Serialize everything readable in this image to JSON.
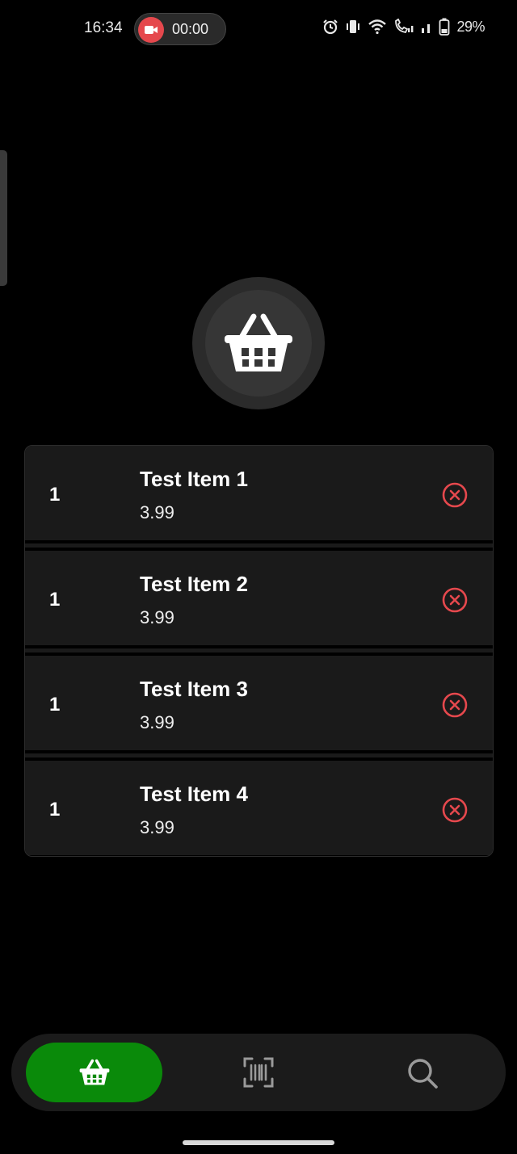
{
  "status_bar": {
    "time": "16:34",
    "recording_time": "00:00",
    "battery_percent": "29%",
    "icons": [
      "alarm-icon",
      "vibrate-icon",
      "wifi-icon",
      "wifi-calling-icon",
      "signal-icon",
      "battery-icon"
    ]
  },
  "header": {
    "icon": "basket-icon"
  },
  "cart": {
    "items": [
      {
        "quantity": "1",
        "name": "Test Item 1",
        "price": "3.99"
      },
      {
        "quantity": "1",
        "name": "Test Item 2",
        "price": "3.99"
      },
      {
        "quantity": "1",
        "name": "Test Item 3",
        "price": "3.99"
      },
      {
        "quantity": "1",
        "name": "Test Item 4",
        "price": "3.99"
      }
    ]
  },
  "bottom_nav": {
    "items": [
      {
        "icon": "basket-icon",
        "active": true
      },
      {
        "icon": "barcode-scan-icon",
        "active": false
      },
      {
        "icon": "search-icon",
        "active": false
      }
    ]
  },
  "colors": {
    "background": "#000000",
    "card": "#1a1a1a",
    "remove": "#e5484d",
    "active_nav": "#0a8a0a",
    "recording": "#e5484d"
  }
}
